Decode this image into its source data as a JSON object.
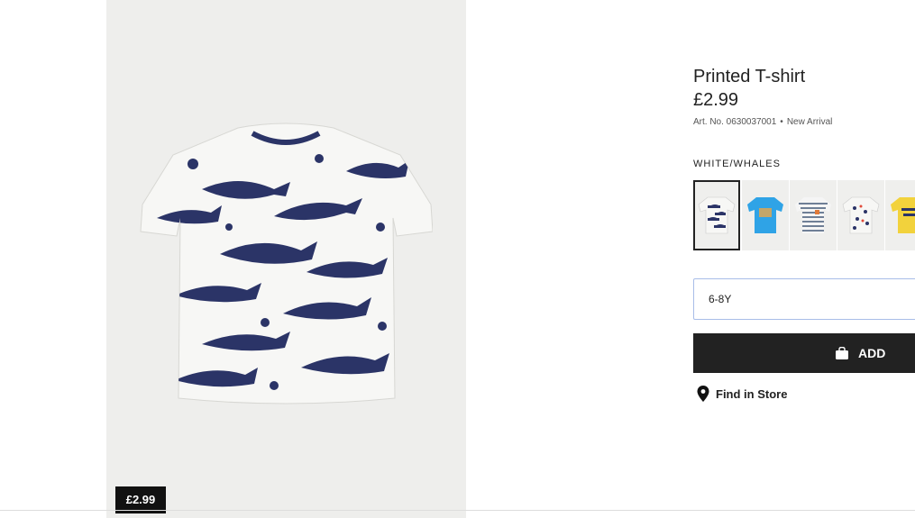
{
  "product": {
    "title": "Printed T-shirt",
    "price": "£2.99",
    "art_no": "Art. No. 0630037001",
    "separator": "•",
    "badge": "New Arrival",
    "color_name": "WHITE/WHALES"
  },
  "image_panel": {
    "price_tag": "£2.99"
  },
  "swatches": [
    {
      "name": "white-whales",
      "selected": true
    },
    {
      "name": "blue-print"
    },
    {
      "name": "grey-stripes"
    },
    {
      "name": "white-boats"
    },
    {
      "name": "yellow-venice-beach"
    }
  ],
  "size_select": {
    "value": "6-8Y"
  },
  "add_button": {
    "label": "ADD",
    "icon": "bag-icon"
  },
  "find_in_store": {
    "label": "Find in Store",
    "icon": "location-pin-icon"
  },
  "colors": {
    "dark": "#222222",
    "navy": "#2b3467",
    "panel_bg": "#eeeeec",
    "select_border": "#a8bde8"
  }
}
